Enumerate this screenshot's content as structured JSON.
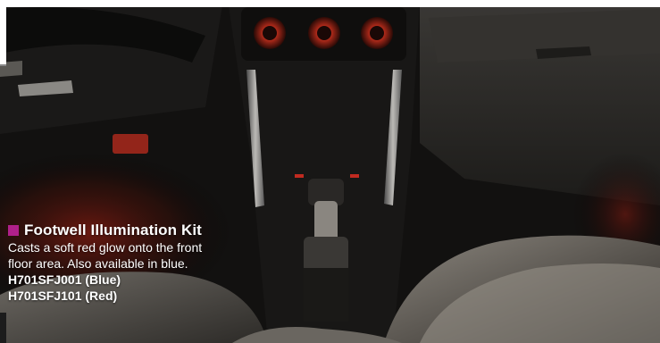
{
  "caption": {
    "bullet_color": "#b0208a",
    "title": "Footwell Illumination Kit",
    "description_line1": "Casts a soft red glow onto the front",
    "description_line2": "floor area. Also available in blue.",
    "part_blue": "H701SFJ001 (Blue)",
    "part_red": "H701SFJ101 (Red)"
  },
  "photo": {
    "subject": "car-interior-center-console",
    "glow_color": "#8a1a12"
  }
}
